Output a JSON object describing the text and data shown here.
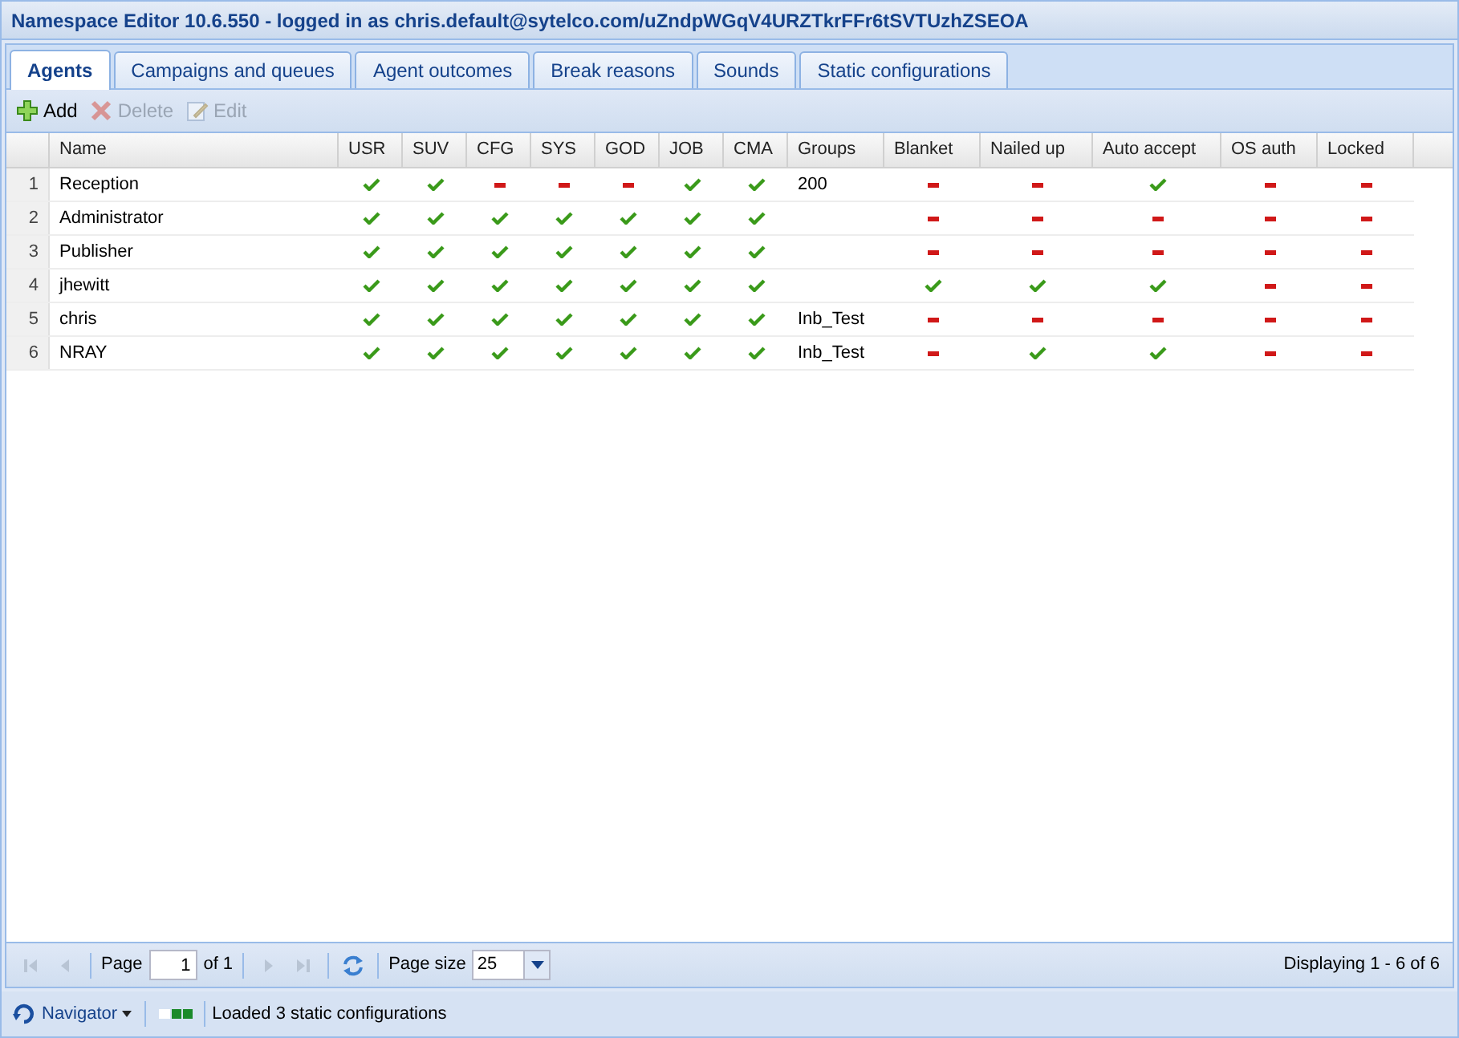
{
  "window": {
    "title": "Namespace Editor 10.6.550 - logged in as chris.default@sytelco.com/uZndpWGqV4URZTkrFFr6tSVTUzhZSEOA"
  },
  "tabs": [
    {
      "label": "Agents",
      "selected": true
    },
    {
      "label": "Campaigns and queues",
      "selected": false
    },
    {
      "label": "Agent outcomes",
      "selected": false
    },
    {
      "label": "Break reasons",
      "selected": false
    },
    {
      "label": "Sounds",
      "selected": false
    },
    {
      "label": "Static configurations",
      "selected": false
    }
  ],
  "toolbar": [
    {
      "label": "Add",
      "kind": "add",
      "disabled": false
    },
    {
      "label": "Delete",
      "kind": "delete",
      "disabled": true
    },
    {
      "label": "Edit",
      "kind": "edit",
      "disabled": true
    }
  ],
  "table": {
    "columns": [
      {
        "label": "Name",
        "kind": "name"
      },
      {
        "label": "USR",
        "kind": "flag"
      },
      {
        "label": "SUV",
        "kind": "flag"
      },
      {
        "label": "CFG",
        "kind": "flag"
      },
      {
        "label": "SYS",
        "kind": "flag"
      },
      {
        "label": "GOD",
        "kind": "flag"
      },
      {
        "label": "JOB",
        "kind": "flag"
      },
      {
        "label": "CMA",
        "kind": "flag"
      },
      {
        "label": "Groups",
        "kind": "groups"
      },
      {
        "label": "Blanket",
        "kind": "flag"
      },
      {
        "label": "Nailed up",
        "kind": "flag"
      },
      {
        "label": "Auto accept",
        "kind": "flag"
      },
      {
        "label": "OS auth",
        "kind": "flag"
      },
      {
        "label": "Locked",
        "kind": "flag"
      }
    ],
    "rows": [
      {
        "number": "1",
        "name": "Reception",
        "groups": "200",
        "flags": [
          true,
          true,
          false,
          false,
          false,
          true,
          true,
          false,
          false,
          true,
          false,
          false
        ]
      },
      {
        "number": "2",
        "name": "Administrator",
        "flags": [
          true,
          true,
          true,
          true,
          true,
          true,
          true,
          false,
          false,
          false,
          false,
          false
        ]
      },
      {
        "number": "3",
        "name": "Publisher",
        "flags": [
          true,
          true,
          true,
          true,
          true,
          true,
          true,
          false,
          false,
          false,
          false,
          false
        ]
      },
      {
        "number": "4",
        "name": "jhewitt",
        "flags": [
          true,
          true,
          true,
          true,
          true,
          true,
          true,
          true,
          true,
          true,
          false,
          false
        ]
      },
      {
        "number": "5",
        "name": "chris",
        "groups": "Inb_Test",
        "flags": [
          true,
          true,
          true,
          true,
          true,
          true,
          true,
          false,
          false,
          false,
          false,
          false
        ]
      },
      {
        "number": "6",
        "name": "NRAY",
        "groups": "Inb_Test",
        "flags": [
          true,
          true,
          true,
          true,
          true,
          true,
          true,
          false,
          true,
          true,
          false,
          false
        ]
      }
    ]
  },
  "paging": {
    "first_disabled": true,
    "prev_disabled": true,
    "page_label": "Page",
    "page_value": "1",
    "of_label": "of 1",
    "next_disabled": true,
    "last_disabled": true,
    "page_size_label": "Page size",
    "page_size": "25",
    "displaying": "Displaying 1 - 6 of 6"
  },
  "status_bar": {
    "navigator": "Navigator",
    "message": "Loaded 3 static configurations"
  }
}
